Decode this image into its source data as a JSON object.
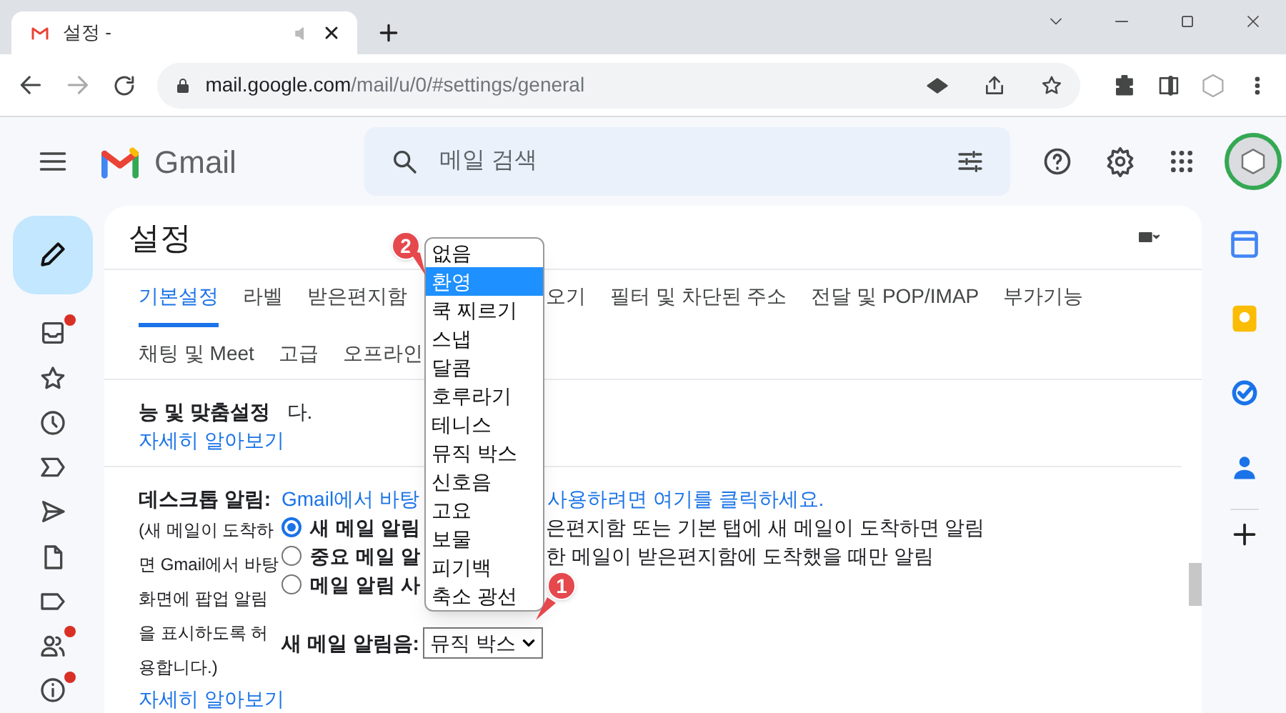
{
  "browser": {
    "tab_title": "설정 -",
    "url_host": "mail.google.com",
    "url_path": "/mail/u/0/#settings/general"
  },
  "header": {
    "app_name": "Gmail",
    "search_placeholder": "메일 검색"
  },
  "nav": [
    {
      "kind": "inbox",
      "dot": true
    },
    {
      "kind": "star",
      "dot": false
    },
    {
      "kind": "clock",
      "dot": false
    },
    {
      "kind": "important",
      "dot": false
    },
    {
      "kind": "send",
      "dot": false
    },
    {
      "kind": "draft",
      "dot": false
    },
    {
      "kind": "label",
      "dot": false
    },
    {
      "kind": "people",
      "dot": true
    },
    {
      "kind": "info",
      "dot": true
    }
  ],
  "settings": {
    "title": "설정",
    "tabs_row1": {
      "before_menu": [
        {
          "label": "기본설정",
          "selected": true
        },
        {
          "label": "라벨",
          "selected": false
        },
        {
          "label": "받은편지함",
          "selected": false
        }
      ],
      "after_menu": [
        {
          "label": "오기",
          "selected": false
        },
        {
          "label": "필터 및 차단된 주소",
          "selected": false
        },
        {
          "label": "전달 및 POP/IMAP",
          "selected": false
        },
        {
          "label": "부가기능",
          "selected": false
        }
      ]
    },
    "tabs_row2": [
      {
        "label": "채팅 및 Meet",
        "selected": false
      },
      {
        "label": "고급",
        "selected": false
      },
      {
        "label": "오프라인",
        "selected": false
      }
    ],
    "intro_bold": "능 및 맞춤설정",
    "intro_rest": "다.",
    "intro_link": "자세히 알아보기",
    "desktop": {
      "label": "데스크톱 알림:",
      "description": "(새 메일이 도착하면 Gmail에서 바탕화면에 팝업 알림을 표시하도록 허용합니다.)",
      "learn_more": "자세히 알아보기",
      "link_parts": [
        "Gmail에서 바탕",
        "사용하려면 여기를 클릭하세요."
      ],
      "options": [
        {
          "label": "새 메일 알림",
          "rest": "은편지함 또는 기본 탭에 새 메일이 도착하면 알림",
          "selected": true
        },
        {
          "label": "중요 메일 알",
          "rest": "한 메일이 받은편지함에 도착했을 때만 알림",
          "selected": false
        },
        {
          "label": "메일 알림 사",
          "selected": false
        }
      ],
      "sound_label": "새 메일 알림음:",
      "sound_value": "뮤직 박스",
      "sound_options": [
        {
          "label": "없음",
          "selected": false
        },
        {
          "label": "환영",
          "selected": true
        },
        {
          "label": "쿡 찌르기",
          "selected": false
        },
        {
          "label": "스냅",
          "selected": false
        },
        {
          "label": "달콤",
          "selected": false
        },
        {
          "label": "호루라기",
          "selected": false
        },
        {
          "label": "테니스",
          "selected": false
        },
        {
          "label": "뮤직 박스",
          "selected": false
        },
        {
          "label": "신호음",
          "selected": false
        },
        {
          "label": "고요",
          "selected": false
        },
        {
          "label": "보물",
          "selected": false
        },
        {
          "label": "피기백",
          "selected": false
        },
        {
          "label": "축소 광선",
          "selected": false
        }
      ]
    }
  },
  "annotations": [
    {
      "number": "2"
    },
    {
      "number": "1"
    }
  ]
}
